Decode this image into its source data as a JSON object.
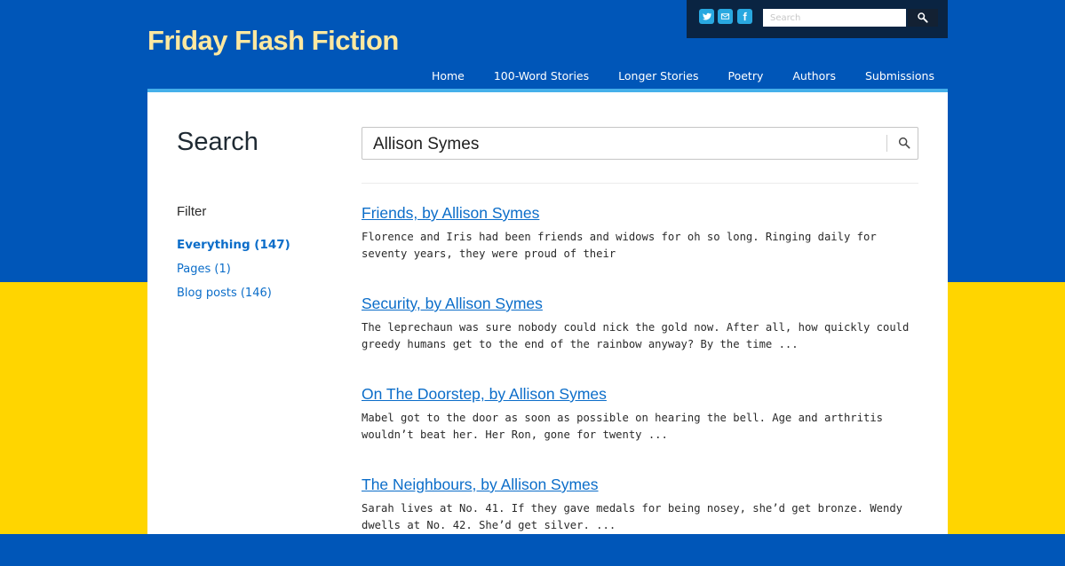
{
  "site": {
    "title": "Friday Flash Fiction"
  },
  "topbar": {
    "social": [
      "twitter-icon",
      "email-icon",
      "facebook-icon"
    ],
    "search_placeholder": "Search"
  },
  "nav": {
    "items": [
      "Home",
      "100-Word Stories",
      "Longer Stories",
      "Poetry",
      "Authors",
      "Submissions"
    ]
  },
  "search": {
    "heading": "Search",
    "query": "Allison Symes"
  },
  "filter": {
    "label": "Filter",
    "items": [
      {
        "label": "Everything (147)",
        "active": true
      },
      {
        "label": "Pages (1)",
        "active": false
      },
      {
        "label": "Blog posts (146)",
        "active": false
      }
    ]
  },
  "results": [
    {
      "title": "Friends, by Allison Symes",
      "excerpt": "Florence and Iris had been friends and widows for oh so long. Ringing daily for seventy years, they were proud of their"
    },
    {
      "title": "Security, by Allison Symes",
      "excerpt": "The leprechaun was sure nobody could nick the gold now. After all, how quickly could greedy humans get to the end of the rainbow anyway? By the time ..."
    },
    {
      "title": "On The Doorstep, by Allison Symes",
      "excerpt": "Mabel got to the door as soon as possible on hearing the bell. Age and arthritis wouldn’t beat her. Her Ron, gone for twenty ..."
    },
    {
      "title": "The Neighbours, by Allison Symes",
      "excerpt": "Sarah lives at No. 41. If they gave medals for being nosey, she’d get bronze. Wendy dwells at No. 42. She’d get silver. ..."
    }
  ],
  "colors": {
    "ukraine_blue": "#0056b8",
    "ukraine_yellow": "#ffd500",
    "link": "#0b6dc9",
    "title": "#fde8a0",
    "accent": "#45b0ea"
  }
}
